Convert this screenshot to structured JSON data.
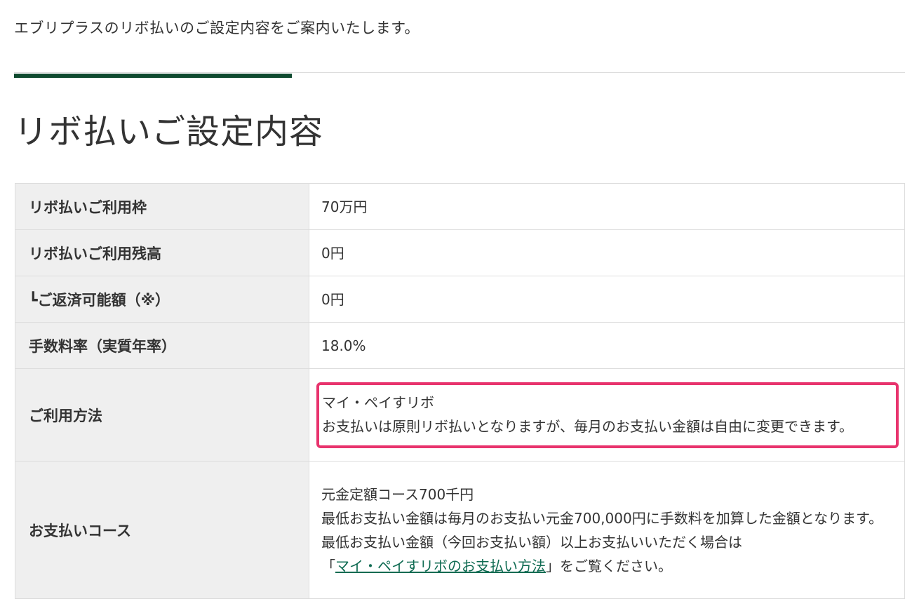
{
  "intro_text": "エブリプラスのリボ払いのご設定内容をご案内いたします。",
  "section_title": "リボ払いご設定内容",
  "colors": {
    "accent_bar": "#0f4a2f",
    "highlight_border": "#e8336d",
    "link": "#0f6b52",
    "label_bg": "#efefef"
  },
  "rows": [
    {
      "label": "リボ払いご利用枠",
      "value": "70万円"
    },
    {
      "label": "リボ払いご利用残高",
      "value": "0円"
    },
    {
      "label": "┗ご返済可能額（※）",
      "value": "0円"
    },
    {
      "label": "手数料率（実質年率）",
      "value": "18.0%"
    },
    {
      "label": "ご利用方法",
      "value_line1": "マイ・ペイすリボ",
      "value_line2": "お支払いは原則リボ払いとなりますが、毎月のお支払い金額は自由に変更できます。"
    },
    {
      "label": "お支払いコース",
      "value_line1": "元金定額コース700千円",
      "value_line2": "最低お支払い金額は毎月のお支払い元金700,000円に手数料を加算した金額となります。",
      "value_line3": "最低お支払い金額（今回お支払い額）以上お支払いいただく場合は",
      "value_line4_prefix": "「",
      "value_line4_link": "マイ・ペイすリボのお支払い方法",
      "value_line4_suffix": "」をご覧ください。"
    }
  ]
}
